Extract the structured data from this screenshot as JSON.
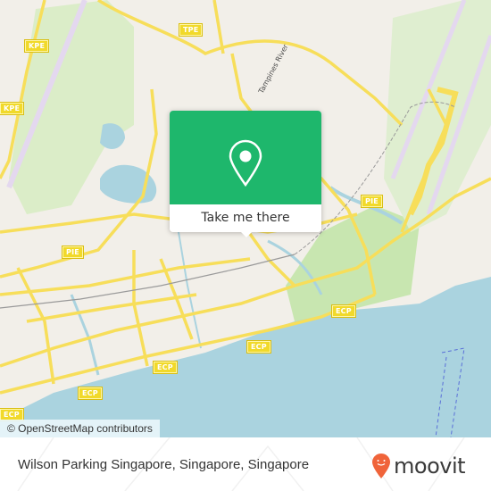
{
  "map": {
    "road_labels": [
      {
        "id": "kpe-1",
        "text": "KPE"
      },
      {
        "id": "kpe-2",
        "text": "KPE"
      },
      {
        "id": "tpe",
        "text": "TPE"
      },
      {
        "id": "pie-1",
        "text": "PIE"
      },
      {
        "id": "pie-2",
        "text": "PIE"
      },
      {
        "id": "ecp-1",
        "text": "ECP"
      },
      {
        "id": "ecp-2",
        "text": "ECP"
      },
      {
        "id": "ecp-3",
        "text": "ECP"
      },
      {
        "id": "ecp-4",
        "text": "ECP"
      },
      {
        "id": "ecp-5",
        "text": "ECP"
      }
    ],
    "river_label": "Tampines River",
    "colors": {
      "land": "#f2efe9",
      "water": "#aad3df",
      "park": "#c8e6b0",
      "road": "#f7de5a",
      "runway": "#e4d8ef"
    }
  },
  "popup": {
    "icon": "map-pin-icon",
    "button_label": "Take me there",
    "accent_color": "#1eb76c"
  },
  "attribution": "© OpenStreetMap contributors",
  "footer": {
    "place_name": "Wilson Parking Singapore, Singapore, Singapore",
    "brand": "moovit",
    "brand_color": "#f0643a"
  }
}
